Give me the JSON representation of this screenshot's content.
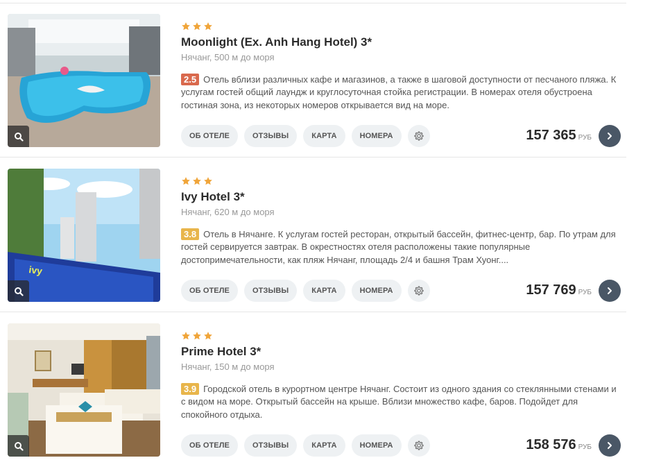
{
  "hotels": [
    {
      "stars": 3,
      "name": "Moonlight (Ex. Anh Hang Hotel) 3*",
      "location": "Нячанг, 500 м до моря",
      "score": "2.5",
      "score_color": "#d9694d",
      "description": "Отель вблизи различных кафе и магазинов, а также в шаговой доступности от песчаного пляжа. К услугам гостей общий лаундж и круглосуточная стойка регистрации. В номерах отеля обустроена гостиная зона, из некоторых номеров открывается вид на море.",
      "buttons": [
        "ОБ ОТЕЛЕ",
        "ОТЗЫВЫ",
        "КАРТА",
        "НОМЕРА"
      ],
      "price": "157 365",
      "currency": "РУБ",
      "image": "pool-icon"
    },
    {
      "stars": 3,
      "name": "Ivy Hotel 3*",
      "location": "Нячанг, 620 м до моря",
      "score": "3.8",
      "score_color": "#e8b54b",
      "description": "Отель в Нячанге. К услугам гостей ресторан, открытый бассейн, фитнес-центр, бар. По утрам для гостей сервируется завтрак. В окрестностях отеля расположены такие популярные достопримечательности, как пляж Нячанг, площадь 2/4 и башня Трам Хуонг....",
      "buttons": [
        "ОБ ОТЕЛЕ",
        "ОТЗЫВЫ",
        "КАРТА",
        "НОМЕРА"
      ],
      "price": "157 769",
      "currency": "РУБ",
      "image": "rooftop-pool-icon"
    },
    {
      "stars": 3,
      "name": "Prime Hotel 3*",
      "location": "Нячанг, 150 м до моря",
      "score": "3.9",
      "score_color": "#e8b54b",
      "description": "Городской отель в курортном центре Нячанг. Состоит из одного здания со стеклянными стенами и с видом на море. Открытый бассейн на крыше. Вблизи множество кафе, баров. Подойдет для спокойного отдыха.",
      "buttons": [
        "ОБ ОТЕЛЕ",
        "ОТЗЫВЫ",
        "КАРТА",
        "НОМЕРА"
      ],
      "price": "158 576",
      "currency": "РУБ",
      "image": "hotel-room-icon"
    }
  ],
  "colors": {
    "star": "#f0a53a",
    "accent_dark": "#4a5766",
    "pill_bg": "#eef1f3"
  }
}
